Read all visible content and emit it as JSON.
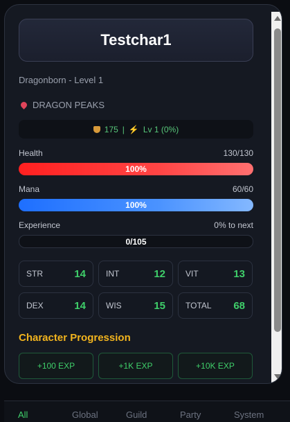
{
  "character": {
    "name": "Testchar1",
    "race_level": "Dragonborn - Level 1",
    "location": "DRAGON PEAKS",
    "gold": "175",
    "level_progress": "Lv 1 (0%)"
  },
  "health": {
    "label": "Health",
    "value": "130/130",
    "percent_text": "100%",
    "fraction": 1.0
  },
  "mana": {
    "label": "Mana",
    "value": "60/60",
    "percent_text": "100%",
    "fraction": 1.0
  },
  "experience": {
    "label": "Experience",
    "to_next": "0% to next",
    "value": "0/105",
    "fraction": 0.0
  },
  "attributes": [
    {
      "label": "STR",
      "value": "14"
    },
    {
      "label": "INT",
      "value": "12"
    },
    {
      "label": "VIT",
      "value": "13"
    },
    {
      "label": "DEX",
      "value": "14"
    },
    {
      "label": "WIS",
      "value": "15"
    },
    {
      "label": "TOTAL",
      "value": "68"
    }
  ],
  "progression": {
    "title": "Character Progression",
    "buttons": [
      "+100 EXP",
      "+1K EXP",
      "+10K EXP"
    ]
  },
  "tabs": [
    "All",
    "Global",
    "Guild",
    "Party",
    "System"
  ],
  "colors": {
    "accent_green": "#3fcf6a",
    "gold": "#f2b41e",
    "health": "#ff2020",
    "mana": "#1e6fff"
  }
}
